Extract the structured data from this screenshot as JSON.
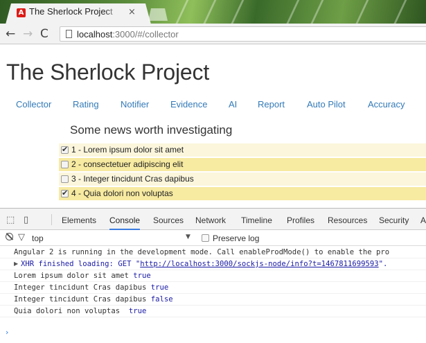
{
  "browser": {
    "tab_title": "The Sherlock Project",
    "tab_close": "×",
    "url_host": "localhost",
    "url_rest": ":3000/#/collector"
  },
  "app": {
    "title": "The Sherlock Project",
    "nav": [
      "Collector",
      "Rating",
      "Notifier",
      "Evidence",
      "AI",
      "Report",
      "Auto Pilot",
      "Accuracy"
    ],
    "section_heading": "Some news worth investigating",
    "items": [
      {
        "label": "1 - Lorem ipsum dolor sit amet",
        "checked": true
      },
      {
        "label": "2 - consectetuer adipiscing elit",
        "checked": false
      },
      {
        "label": "3 - Integer tincidunt Cras dapibus",
        "checked": false
      },
      {
        "label": "4 - Quia dolori non voluptas",
        "checked": true
      }
    ]
  },
  "devtools": {
    "tabs": [
      "Elements",
      "Console",
      "Sources",
      "Network",
      "Timeline",
      "Profiles",
      "Resources",
      "Security",
      "A"
    ],
    "active_tab": "Console",
    "context": "top",
    "preserve_log_label": "Preserve log",
    "console_lines": {
      "line1": "Angular 2 is running in the development mode. Call enableProdMode() to enable the pro",
      "xhr_prefix": "XHR finished loading: GET \"",
      "xhr_url": "http://localhost:3000/sockjs-node/info?t=1467811699593",
      "xhr_suffix": "\".",
      "log1_text": "Lorem ipsum dolor sit amet",
      "log1_val": "true",
      "log2_text": "Integer tincidunt Cras dapibus",
      "log2_val": "true",
      "log3_text": "Integer tincidunt Cras dapibus",
      "log3_val": "false",
      "log4_text": "Quia dolori non voluptas ",
      "log4_val": "true"
    },
    "prompt": "›"
  }
}
